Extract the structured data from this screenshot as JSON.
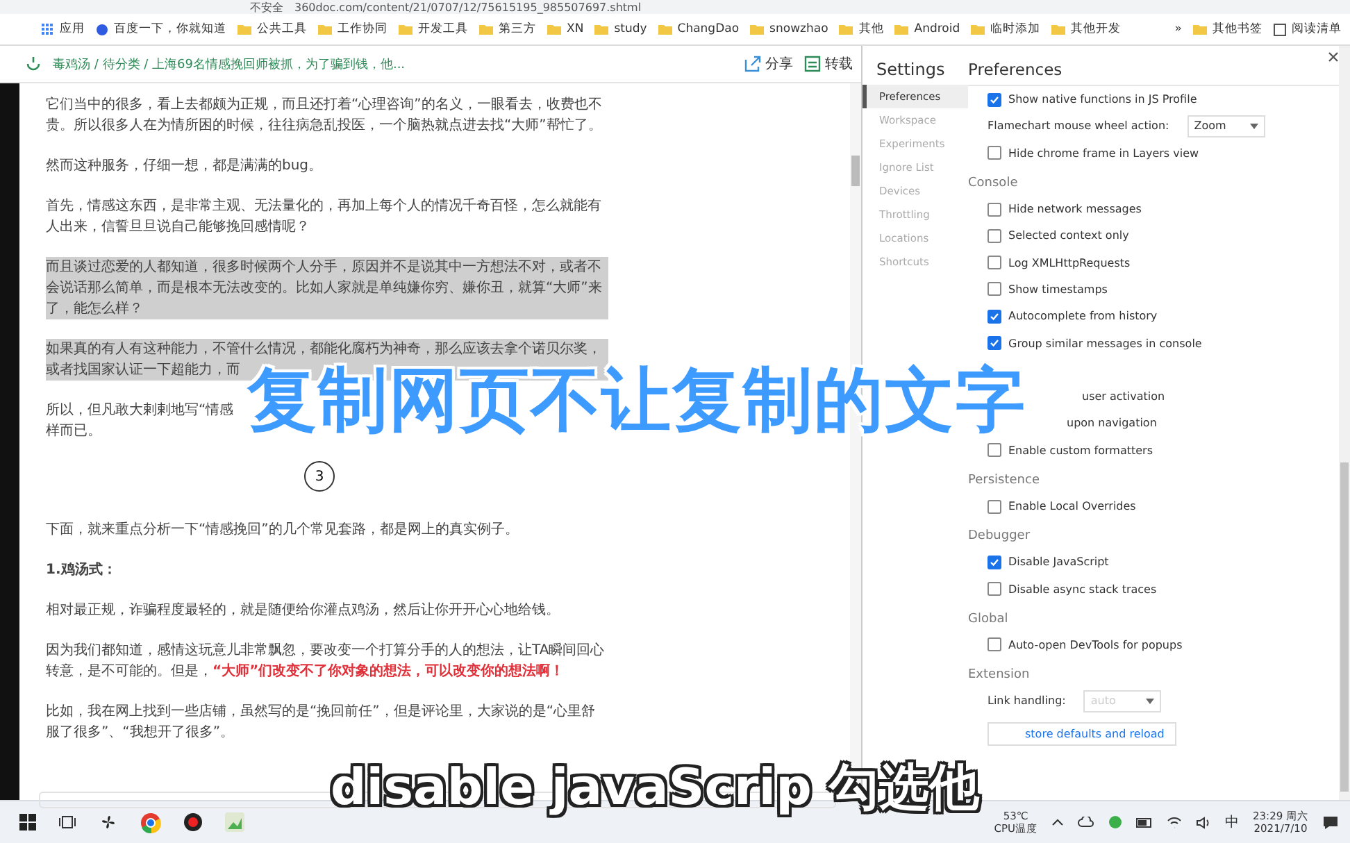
{
  "address_bar": {
    "security": "不安全",
    "url": "360doc.com/content/21/0707/12/75615195_985507697.shtml"
  },
  "bookmarks": [
    {
      "label": "应用",
      "kind": "apps"
    },
    {
      "label": "百度一下，你就知道",
      "kind": "site"
    },
    {
      "label": "公共工具",
      "kind": "folder"
    },
    {
      "label": "工作协同",
      "kind": "folder"
    },
    {
      "label": "开发工具",
      "kind": "folder"
    },
    {
      "label": "第三方",
      "kind": "folder"
    },
    {
      "label": "XN",
      "kind": "folder"
    },
    {
      "label": "study",
      "kind": "folder"
    },
    {
      "label": "ChangDao",
      "kind": "folder"
    },
    {
      "label": "snowzhao",
      "kind": "folder"
    },
    {
      "label": "其他",
      "kind": "folder"
    },
    {
      "label": "Android",
      "kind": "folder"
    },
    {
      "label": "临时添加",
      "kind": "folder"
    },
    {
      "label": "其他开发",
      "kind": "folder"
    }
  ],
  "bookmarks_more": "»",
  "bookmarks_right": [
    {
      "label": "其他书签",
      "kind": "folder"
    },
    {
      "label": "阅读清单",
      "kind": "list"
    }
  ],
  "page_header": {
    "breadcrumb": "毒鸡汤 / 待分类 / 上海69名情感挽回师被抓，为了骗到钱，他...",
    "actions": [
      {
        "label": "分享",
        "kind": "share"
      },
      {
        "label": "转载",
        "kind": "save"
      }
    ]
  },
  "article": [
    {
      "kind": "text",
      "selected": false,
      "text": "它们当中的很多，看上去都颇为正规，而且还打着“心理咨询”的名义，一眼看去，收费也不贵。所以很多人在为情所困的时候，往往病急乱投医，一个脑热就点进去找“大师”帮忙了。"
    },
    {
      "kind": "text",
      "selected": false,
      "text": "然而这种服务，仔细一想，都是满满的bug。"
    },
    {
      "kind": "text",
      "selected": false,
      "text": "首先，情感这东西，是非常主观、无法量化的，再加上每个人的情况千奇百怪，怎么就能有人出来，信誓旦旦说自己能够挽回感情呢？"
    },
    {
      "kind": "text",
      "selected": true,
      "text": "而且谈过恋爱的人都知道，很多时候两个人分手，原因并不是说其中一方想法不对，或者不会说话那么简单，而是根本无法改变的。比如人家就是单纯嫌你穷、嫌你丑，就算“大师”来了，能怎么样？"
    },
    {
      "kind": "text",
      "selected": true,
      "text": "如果真的有人有这种能力，不管什么情况，都能化腐朽为神奇，那么应该去拿个诺贝尔奖，或者找国家认证一下超能力，而"
    },
    {
      "kind": "lines",
      "selected": false,
      "lines": [
        "所以，但凡敢大剌剌地写“情感",
        "样而已。"
      ]
    },
    {
      "kind": "marker",
      "selected": false,
      "text": "3"
    },
    {
      "kind": "text",
      "selected": false,
      "text": "下面，就来重点分析一下“情感挽回”的几个常见套路，都是网上的真实例子。"
    },
    {
      "kind": "heading",
      "selected": false,
      "text": "1.鸡汤式："
    },
    {
      "kind": "text",
      "selected": false,
      "text": "相对最正规，诈骗程度最轻的，就是随便给你灌点鸡汤，然后让你开开心心地给钱。"
    },
    {
      "kind": "text",
      "selected": false,
      "text": "因为我们都知道，感情这玩意儿非常飘忽，要改变一个打算分手的人的想法，让TA瞬间回心转意，是不可能的。但是，**“大师”们改变不了你对象的想法，可以改变你的想法啊！**"
    },
    {
      "kind": "text",
      "selected": false,
      "text": "比如，我在网上找到一些店铺，虽然写的是“挽回前任”，但是评论里，大家说的是“心里舒服了很多”、“我想开了很多”。"
    }
  ],
  "devtools": {
    "title": "Settings",
    "heading": "Preferences",
    "nav": [
      {
        "label": "Preferences",
        "selected": true
      },
      {
        "label": "Workspace",
        "selected": false
      },
      {
        "label": "Experiments",
        "selected": false
      },
      {
        "label": "Ignore List",
        "selected": false
      },
      {
        "label": "Devices",
        "selected": false
      },
      {
        "label": "Throttling",
        "selected": false
      },
      {
        "label": "Locations",
        "selected": false
      },
      {
        "label": "Shortcuts",
        "selected": false
      }
    ],
    "sections": [
      {
        "items": [
          {
            "kind": "checkbox",
            "label": "Show native functions in JS Profile",
            "checked": true
          },
          {
            "kind": "select",
            "label": "Flamechart mouse wheel action:",
            "value": "Zoom",
            "disabled": false
          },
          {
            "kind": "checkbox",
            "label": "Hide chrome frame in Layers view",
            "checked": false
          }
        ]
      },
      {
        "title": "Console",
        "items": [
          {
            "kind": "checkbox",
            "label": "Hide network messages",
            "checked": false
          },
          {
            "kind": "checkbox",
            "label": "Selected context only",
            "checked": false
          },
          {
            "kind": "checkbox",
            "label": "Log XMLHttpRequests",
            "checked": false
          },
          {
            "kind": "checkbox",
            "label": "Show timestamps",
            "checked": false
          },
          {
            "kind": "checkbox",
            "label": "Autocomplete from history",
            "checked": true
          },
          {
            "kind": "checkbox",
            "label": "Group similar messages in console",
            "checked": true
          },
          {
            "kind": "blank"
          },
          {
            "kind": "fragment",
            "label": "user activation"
          },
          {
            "kind": "fragment",
            "label": "upon navigation"
          },
          {
            "kind": "checkbox",
            "label": "Enable custom formatters",
            "checked": false
          }
        ]
      },
      {
        "title": "Persistence",
        "items": [
          {
            "kind": "checkbox",
            "label": "Enable Local Overrides",
            "checked": false
          }
        ]
      },
      {
        "title": "Debugger",
        "items": [
          {
            "kind": "checkbox",
            "label": "Disable JavaScript",
            "checked": true
          },
          {
            "kind": "checkbox",
            "label": "Disable async stack traces",
            "checked": false
          }
        ]
      },
      {
        "title": "Global",
        "items": [
          {
            "kind": "checkbox",
            "label": "Auto-open DevTools for popups",
            "checked": false
          }
        ]
      },
      {
        "title": "Extension",
        "items": [
          {
            "kind": "select",
            "label": "Link handling:",
            "value": "auto",
            "disabled": true
          }
        ]
      }
    ],
    "button": "store defaults and reload"
  },
  "taskbar": {
    "temperature": "53℃",
    "temperature_label": "CPU温度",
    "ime": "中",
    "time": "23:29 周六",
    "date": "2021/7/10"
  },
  "captions": [
    {
      "kind": "title",
      "text": "复制网页不让复制的文字"
    },
    {
      "kind": "subtitle",
      "text": "disable javaScrip 勾选他"
    }
  ]
}
